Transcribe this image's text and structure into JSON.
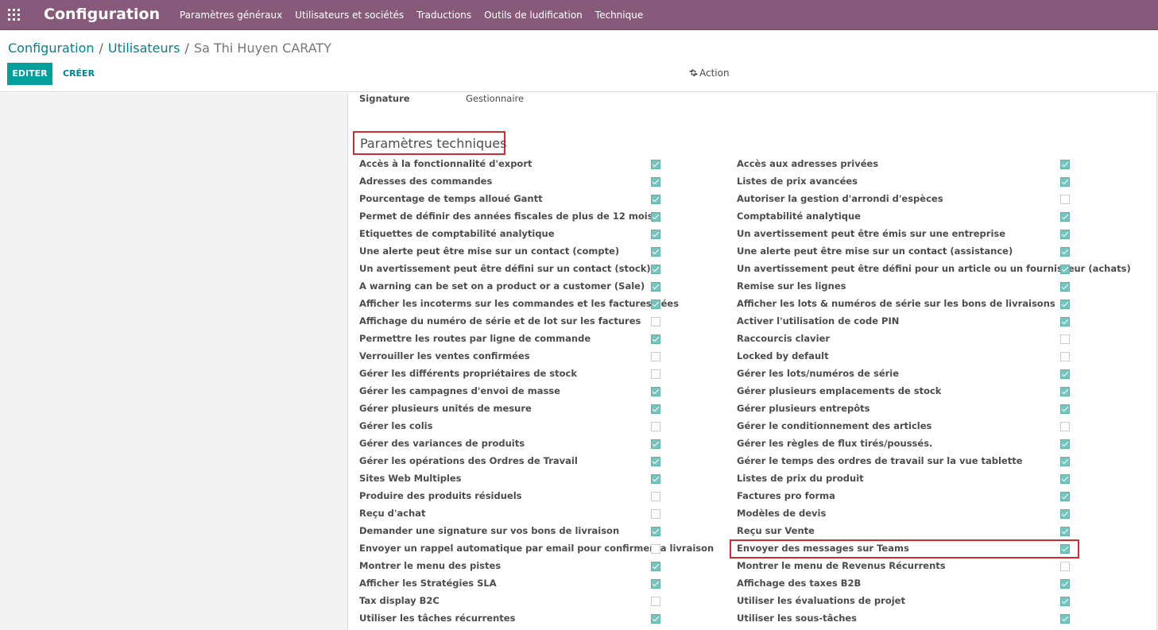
{
  "topbar": {
    "app_title": "Configuration",
    "menu": [
      "Paramètres généraux",
      "Utilisateurs et sociétés",
      "Traductions",
      "Outils de ludification",
      "Technique"
    ]
  },
  "breadcrumb": {
    "items": [
      "Configuration",
      "Utilisateurs"
    ],
    "separator": "/",
    "current": "Sa Thi Huyen CARATY"
  },
  "buttons": {
    "edit": "EDITER",
    "create": "CRÉER",
    "action": "Action"
  },
  "form": {
    "signature_label": "Signature",
    "signature_value": "Gestionnaire",
    "section_title": "Paramètres techniques",
    "highlighted_row": "Envoyer des messages sur Teams",
    "left": [
      {
        "label": "Accès à la fonctionnalité d'export",
        "checked": true
      },
      {
        "label": "Adresses des commandes",
        "checked": true
      },
      {
        "label": "Pourcentage de temps alloué Gantt",
        "checked": true
      },
      {
        "label": "Permet de définir des années fiscales de plus de 12 mois",
        "checked": true
      },
      {
        "label": "Etiquettes de comptabilité analytique",
        "checked": true
      },
      {
        "label": "Une alerte peut être mise sur un contact (compte)",
        "checked": true
      },
      {
        "label": "Un avertissement peut être défini sur un contact (stock)",
        "checked": true
      },
      {
        "label": "A warning can be set on a product or a customer (Sale)",
        "checked": true
      },
      {
        "label": "Afficher les incoterms sur les commandes et les factures liées",
        "checked": true
      },
      {
        "label": "Affichage du numéro de série et de lot sur les factures",
        "checked": false
      },
      {
        "label": "Permettre les routes par ligne de commande",
        "checked": true
      },
      {
        "label": "Verrouiller les ventes confirmées",
        "checked": false
      },
      {
        "label": "Gérer les différents propriétaires de stock",
        "checked": false
      },
      {
        "label": "Gérer les campagnes d'envoi de masse",
        "checked": true
      },
      {
        "label": "Gérer plusieurs unités de mesure",
        "checked": true
      },
      {
        "label": "Gérer les colis",
        "checked": false
      },
      {
        "label": "Gérer des variances de produits",
        "checked": true
      },
      {
        "label": "Gérer les opérations des Ordres de Travail",
        "checked": true
      },
      {
        "label": "Sites Web Multiples",
        "checked": true
      },
      {
        "label": "Produire des produits résiduels",
        "checked": false
      },
      {
        "label": "Reçu d'achat",
        "checked": false
      },
      {
        "label": "Demander une signature sur vos bons de livraison",
        "checked": true
      },
      {
        "label": "Envoyer un rappel automatique par email pour confirmer la livraison",
        "checked": false
      },
      {
        "label": "Montrer le menu des pistes",
        "checked": true
      },
      {
        "label": "Afficher les Stratégies SLA",
        "checked": true
      },
      {
        "label": "Tax display B2C",
        "checked": false
      },
      {
        "label": "Utiliser les tâches récurrentes",
        "checked": true
      }
    ],
    "right": [
      {
        "label": "Accès aux adresses privées",
        "checked": true
      },
      {
        "label": "Listes de prix avancées",
        "checked": true
      },
      {
        "label": "Autoriser la gestion d'arrondi d'espèces",
        "checked": false
      },
      {
        "label": "Comptabilité analytique",
        "checked": true
      },
      {
        "label": "Un avertissement peut être émis sur une entreprise",
        "checked": true
      },
      {
        "label": "Une alerte peut être mise sur un contact (assistance)",
        "checked": true
      },
      {
        "label": "Un avertissement peut être défini pour un article ou un fournisseur (achats)",
        "checked": true
      },
      {
        "label": "Remise sur les lignes",
        "checked": true
      },
      {
        "label": "Afficher les lots & numéros de série sur les bons de livraisons",
        "checked": true
      },
      {
        "label": "Activer l'utilisation de code PIN",
        "checked": true
      },
      {
        "label": "Raccourcis clavier",
        "checked": false
      },
      {
        "label": "Locked by default",
        "checked": false
      },
      {
        "label": "Gérer les lots/numéros de série",
        "checked": true
      },
      {
        "label": "Gérer plusieurs emplacements de stock",
        "checked": true
      },
      {
        "label": "Gérer plusieurs entrepôts",
        "checked": true
      },
      {
        "label": "Gérer le conditionnement des articles",
        "checked": false
      },
      {
        "label": "Gérer les règles de flux tirés/poussés.",
        "checked": true
      },
      {
        "label": "Gérer le temps des ordres de travail sur la vue tablette",
        "checked": true
      },
      {
        "label": "Listes de prix du produit",
        "checked": true
      },
      {
        "label": "Factures pro forma",
        "checked": true
      },
      {
        "label": "Modèles de devis",
        "checked": true
      },
      {
        "label": "Reçu sur Vente",
        "checked": true
      },
      {
        "label": "Envoyer des messages sur Teams",
        "checked": true
      },
      {
        "label": "Montrer le menu de Revenus Récurrents",
        "checked": false
      },
      {
        "label": "Affichage des taxes B2B",
        "checked": true
      },
      {
        "label": "Utiliser les évaluations de projet",
        "checked": true
      },
      {
        "label": "Utiliser les sous-tâches",
        "checked": true
      }
    ]
  },
  "colors": {
    "topbar": "#875a7b",
    "primary_button": "#00a09d",
    "link": "#00838f",
    "checkbox_checked": "#75c5be",
    "annotation_red": "#d02c32"
  },
  "icons": {
    "apps": "apps-grid-icon",
    "action": "gear-icon"
  }
}
